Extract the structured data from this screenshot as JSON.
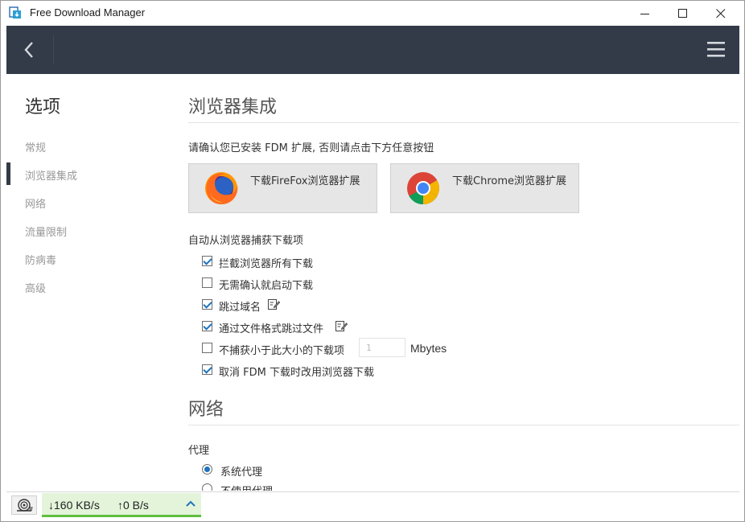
{
  "window": {
    "title": "Free Download Manager"
  },
  "sidebar": {
    "title": "选项",
    "items": [
      {
        "label": "常规"
      },
      {
        "label": "浏览器集成"
      },
      {
        "label": "网络"
      },
      {
        "label": "流量限制"
      },
      {
        "label": "防病毒"
      },
      {
        "label": "高级"
      }
    ],
    "active_index": 1
  },
  "browser_integration": {
    "title": "浏览器集成",
    "instruction": "请确认您已安装 FDM 扩展, 否则请点击下方任意按钮",
    "firefox_button": "下载FireFox浏览器扩展",
    "chrome_button": "下载Chrome浏览器扩展",
    "auto_capture_label": "自动从浏览器捕获下载项",
    "options": [
      {
        "label": "拦截浏览器所有下载",
        "checked": true
      },
      {
        "label": "无需确认就启动下载",
        "checked": false
      },
      {
        "label": "跳过域名",
        "checked": true
      },
      {
        "label": "通过文件格式跳过文件",
        "checked": true
      },
      {
        "label": "不捕获小于此大小的下载项",
        "checked": false
      },
      {
        "label": "取消 FDM 下载时改用浏览器下载",
        "checked": true
      }
    ],
    "size_value": "1",
    "size_unit": "Mbytes"
  },
  "network": {
    "title": "网络",
    "proxy_label": "代理",
    "proxy_options": [
      {
        "label": "系统代理",
        "selected": true
      },
      {
        "label": "不使用代理",
        "selected": false
      }
    ]
  },
  "statusbar": {
    "download_speed": "160 KB/s",
    "upload_speed": "0 B/s"
  },
  "colors": {
    "header_bg": "#333b48",
    "accent_blue": "#1e73be",
    "speed_panel_bg": "#e3f4da",
    "speed_panel_border": "#5fbf3f"
  }
}
